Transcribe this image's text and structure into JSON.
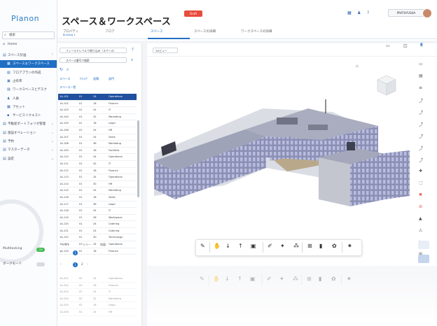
{
  "app": {
    "logo": "Planon"
  },
  "sidebar": {
    "search": "検索",
    "items": [
      {
        "icon": "⌂",
        "label": "Home",
        "level": 0
      },
      {
        "icon": "▤",
        "label": "スペース計画",
        "level": 0,
        "arrow": "⌃"
      },
      {
        "icon": "▦",
        "label": "スペース＆ワークスペース",
        "level": 1,
        "active": true
      },
      {
        "icon": "▧",
        "label": "フロアプランの作成",
        "level": 1
      },
      {
        "icon": "▣",
        "label": "占有率",
        "level": 1
      },
      {
        "icon": "▨",
        "label": "ワークスペースとデスク",
        "level": 1
      },
      {
        "icon": "♟",
        "label": "人員",
        "level": 1
      },
      {
        "icon": "▩",
        "label": "アセット",
        "level": 1
      },
      {
        "icon": "▪",
        "label": "サービスリクエスト",
        "level": 1
      },
      {
        "icon": "▤",
        "label": "不動産ポートフォリオ管理",
        "level": 0,
        "arrow": "⌄"
      },
      {
        "icon": "▤",
        "label": "施設オペレーション",
        "level": 0,
        "arrow": "⌄"
      },
      {
        "icon": "▤",
        "label": "予約",
        "level": 0,
        "arrow": "⌄"
      },
      {
        "icon": "▤",
        "label": "マスターデータ",
        "level": 0,
        "arrow": "⌄"
      },
      {
        "icon": "▤",
        "label": "設定",
        "level": 0,
        "arrow": "⌄"
      }
    ],
    "toggles": [
      {
        "label": "Multitasking",
        "on": true
      },
      {
        "label": "ダークモード",
        "on": false
      }
    ]
  },
  "header": {
    "title": "スペース＆ワークスペース",
    "badge": "Draft",
    "user": "PRATHYUSHA",
    "tabs": [
      {
        "label": "プロパティ",
        "sub": "Building 1"
      },
      {
        "label": "フロア",
        "sub": ""
      },
      {
        "label": "スペース",
        "sub": ""
      },
      {
        "label": "スペースの詳細",
        "sub": ""
      },
      {
        "label": "ワークスペースの詳細",
        "sub": ""
      }
    ]
  },
  "panel": {
    "filter": "フィールドレベルで絞り込み（スペース）",
    "filter2": "スペース番号で検索",
    "columns": [
      "スペース",
      "フロア",
      "面積",
      "部門"
    ],
    "subheader": "スペース一覧",
    "rows": [
      [
        "1A-101",
        "01",
        "24",
        "Operations"
      ],
      [
        "1A-102",
        "01",
        "18",
        "Finance"
      ],
      [
        "1A-103",
        "01",
        "24",
        "IT"
      ],
      [
        "1A-104",
        "01",
        "32",
        "Marketing"
      ],
      [
        "1A-105",
        "01",
        "18",
        "Legal"
      ],
      [
        "1A-106",
        "01",
        "24",
        "HR"
      ],
      [
        "1A-107",
        "01",
        "24",
        "Sales"
      ],
      [
        "1A-108",
        "01",
        "36",
        "Marketing"
      ],
      [
        "1A-109",
        "01",
        "18",
        "Facilities"
      ],
      [
        "1A-110",
        "01",
        "24",
        "Operations"
      ],
      [
        "1A-111",
        "01",
        "42",
        "IT"
      ],
      [
        "1A-112",
        "01",
        "18",
        "Finance"
      ],
      [
        "1A-113",
        "01",
        "24",
        "Operations"
      ],
      [
        "1A-114",
        "01",
        "30",
        "HR"
      ],
      [
        "1A-115",
        "01",
        "24",
        "Marketing"
      ],
      [
        "1A-116",
        "01",
        "18",
        "Sales"
      ],
      [
        "1A-117",
        "01",
        "36",
        "Legal"
      ],
      [
        "1A-118",
        "01",
        "24",
        "IT"
      ],
      [
        "1A-119",
        "01",
        "28",
        "Workspace"
      ],
      [
        "1A-120",
        "01",
        "24",
        "Catering"
      ],
      [
        "1A-121",
        "01",
        "24",
        "Catering"
      ],
      [
        "1A-122",
        "01",
        "30",
        "Technology"
      ],
      [
        "1A-123",
        "01",
        "24",
        "Operations"
      ],
      [
        "1A-124",
        "01",
        "18",
        "Finance"
      ]
    ],
    "bottom_tabs": [
      "リスト",
      "ツリー",
      "地図"
    ],
    "pager": [
      "1",
      "2",
      "3"
    ],
    "bottom_rows": [
      [
        "1A-201",
        "02",
        "24",
        "Operations"
      ],
      [
        "1A-202",
        "02",
        "18",
        "Finance"
      ],
      [
        "1A-203",
        "02",
        "24",
        "IT"
      ],
      [
        "1A-204",
        "02",
        "32",
        "Marketing"
      ],
      [
        "1A-205",
        "02",
        "18",
        "Legal"
      ],
      [
        "1A-206",
        "02",
        "24",
        "HR"
      ]
    ]
  },
  "viewer": {
    "view_select": "3Dビュー",
    "bottom_tools": [
      "✎",
      "✋",
      "↓",
      "↑",
      "▣",
      "✐",
      "✦",
      "⁂",
      "⊞",
      "▮",
      "✿",
      "✷"
    ],
    "right_tools": [
      "▭",
      "▤",
      "≡",
      "⤴",
      "⤴",
      "⤴",
      "⤴",
      "⤴",
      "⤴",
      "✚",
      "⬚",
      "✖",
      "⊘",
      "▲",
      "⚠",
      "✎",
      "⊞"
    ]
  },
  "colors": {
    "accent": "#1f6fc4",
    "badge": "#e74c3c",
    "toggle_on": "#3fb950"
  }
}
